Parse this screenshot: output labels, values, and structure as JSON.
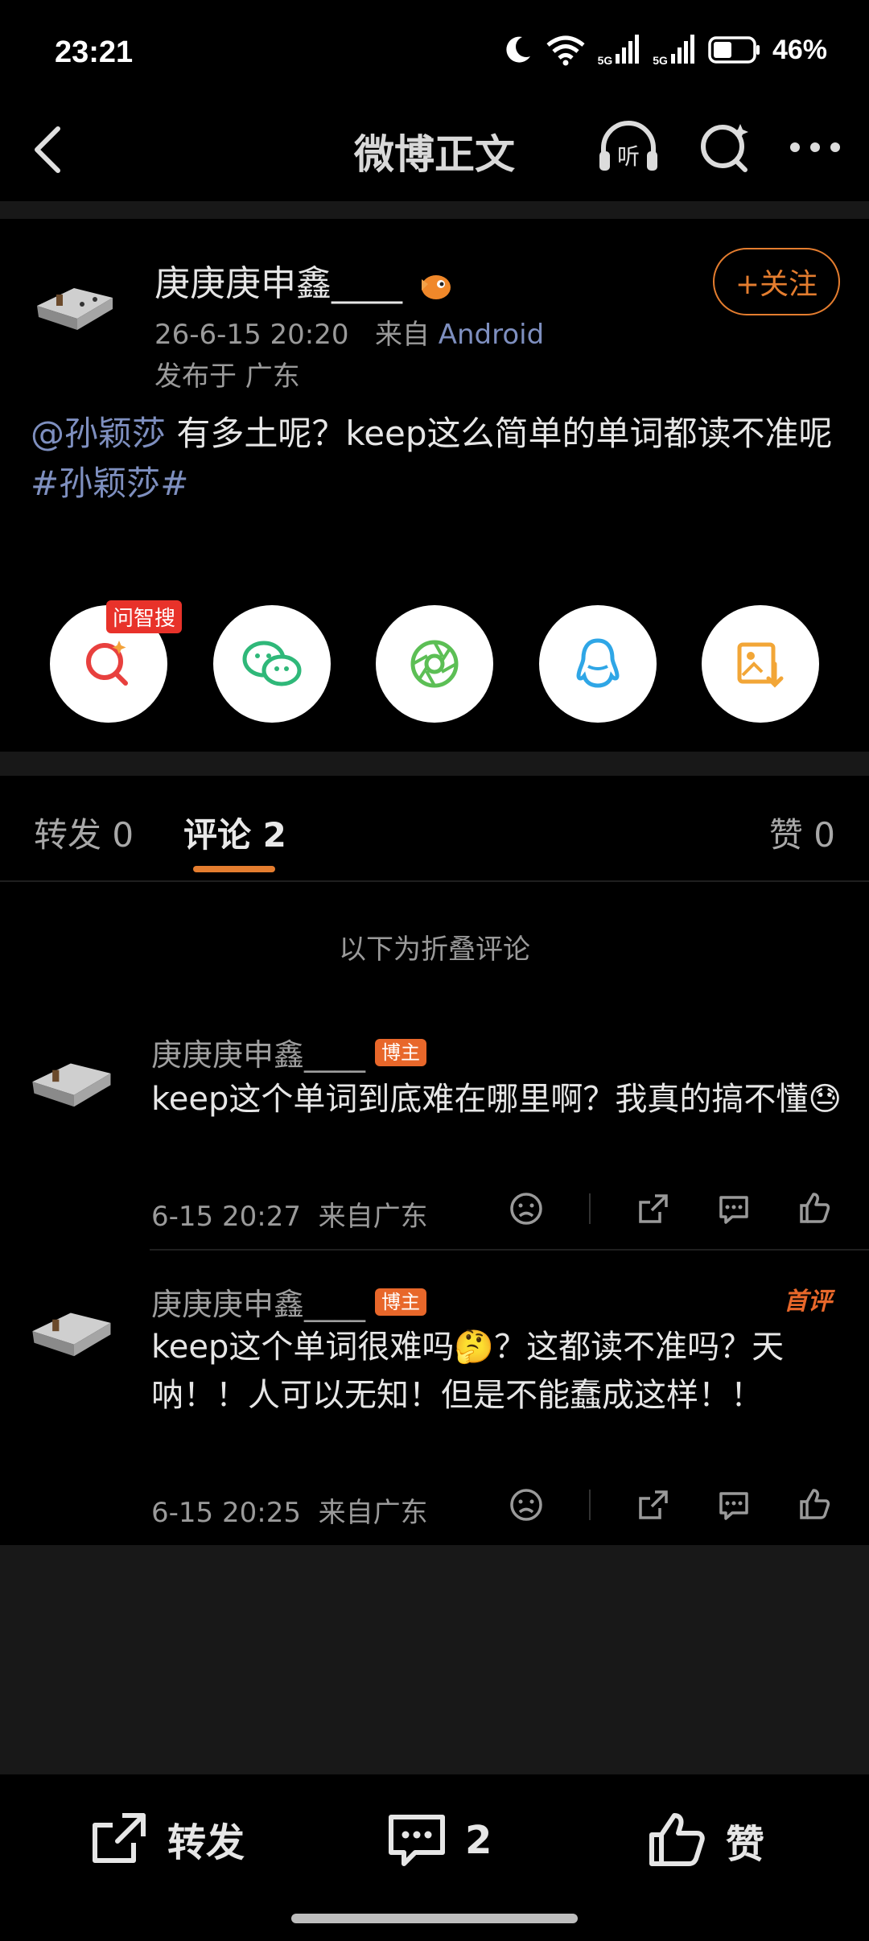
{
  "status": {
    "time": "23:21",
    "battery": "46%",
    "net1": "5G",
    "net2": "5G"
  },
  "nav": {
    "title": "微博正文"
  },
  "post": {
    "author": "庚庚庚申鑫____",
    "time": "26-6-15 20:20",
    "source_prefix": "来自",
    "source": "Android",
    "location": "发布于 广东",
    "follow_label": "+关注",
    "mention": "@孙颖莎",
    "text": " 有多土呢？keep这么简单的单词都读不准呢",
    "hashtag": "#孙颖莎#",
    "ai_search_badge": "问智搜"
  },
  "tabs": {
    "repost": "转发 0",
    "comments": "评论 2",
    "likes": "赞 0"
  },
  "folded_notice": "以下为折叠评论",
  "comments": [
    {
      "author": "庚庚庚申鑫____",
      "badge": "博主",
      "text": "keep这个单词到底难在哪里啊？我真的搞不懂😓",
      "time": "6-15 20:27",
      "location": "来自广东",
      "first_badge": ""
    },
    {
      "author": "庚庚庚申鑫____",
      "badge": "博主",
      "text": "keep这个单词很难吗🤔？这都读不准吗？天呐！！人可以无知！但是不能蠢成这样！！",
      "time": "6-15 20:25",
      "location": "来自广东",
      "first_badge": "首评"
    }
  ],
  "bottom": {
    "repost": "转发",
    "comments": "2",
    "like": "赞"
  },
  "colors": {
    "accent": "#e47d2f",
    "link": "#7e8fbf",
    "badge": "#e8672a"
  },
  "icons": [
    "back-icon",
    "headphone-icon",
    "search-icon",
    "more-icon",
    "ai-search-icon",
    "wechat-icon",
    "moments-icon",
    "qq-icon",
    "save-image-icon",
    "dislike-icon",
    "share-icon",
    "reply-icon",
    "like-icon"
  ]
}
